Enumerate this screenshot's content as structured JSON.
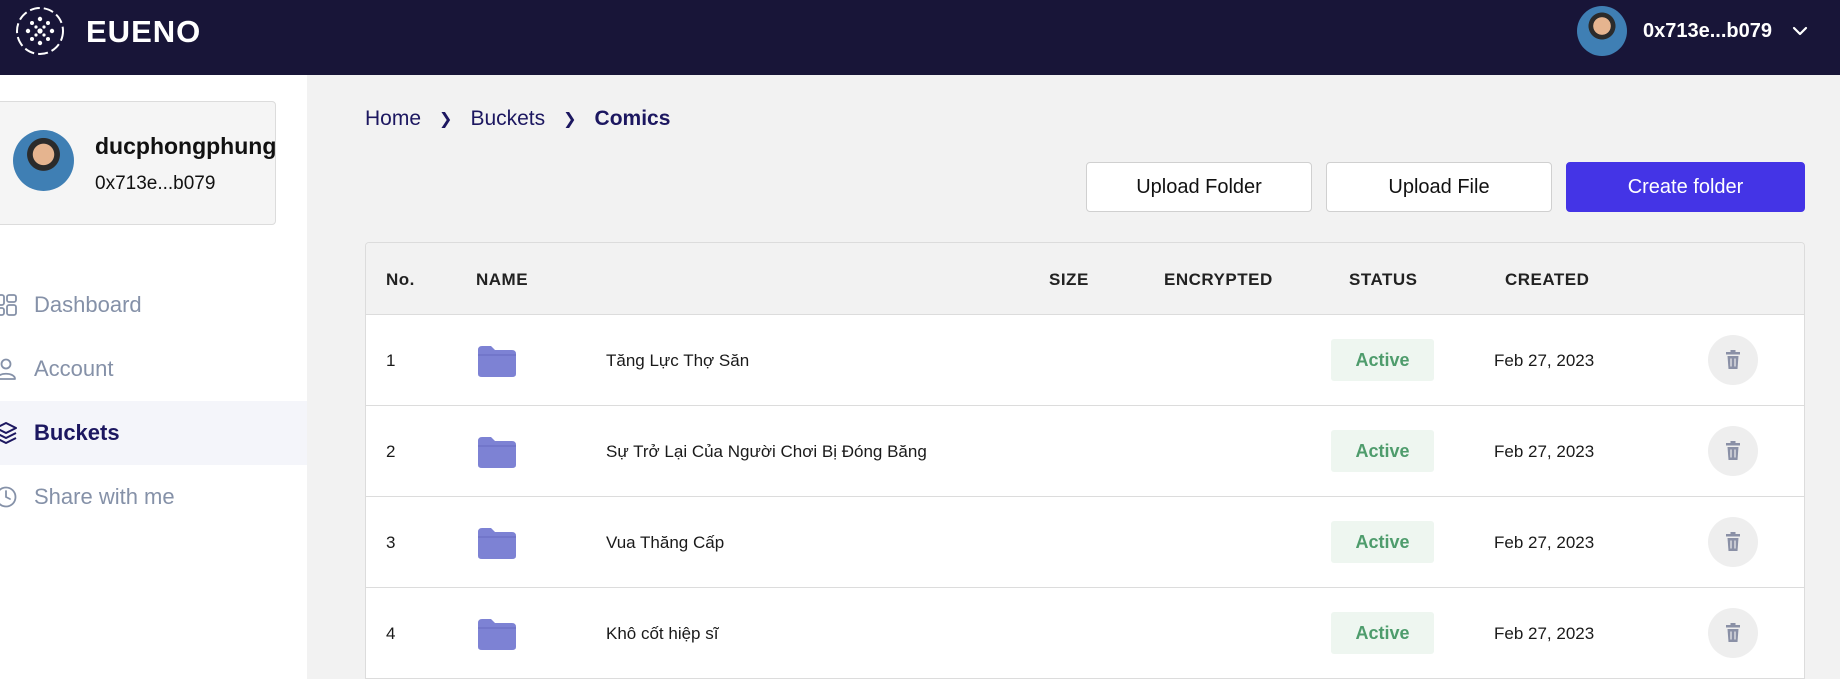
{
  "header": {
    "brand": "EUENO",
    "user_address": "0x713e...b079"
  },
  "sidebar": {
    "profile": {
      "name": "ducphongphung",
      "address": "0x713e...b079"
    },
    "items": [
      {
        "label": "Dashboard",
        "icon": "dashboard-icon",
        "active": false
      },
      {
        "label": "Account",
        "icon": "user-icon",
        "active": false
      },
      {
        "label": "Buckets",
        "icon": "layers-icon",
        "active": true
      },
      {
        "label": "Share with me",
        "icon": "clock-icon",
        "active": false
      }
    ]
  },
  "breadcrumb": [
    "Home",
    "Buckets",
    "Comics"
  ],
  "actions": {
    "upload_folder": "Upload Folder",
    "upload_file": "Upload File",
    "create_folder": "Create folder"
  },
  "table": {
    "columns": [
      "No.",
      "NAME",
      "SIZE",
      "ENCRYPTED",
      "STATUS",
      "CREATED"
    ],
    "rows": [
      {
        "no": "1",
        "name": "Tăng Lực Thợ Săn",
        "size": "",
        "encrypted": "",
        "status": "Active",
        "created": "Feb 27, 2023"
      },
      {
        "no": "2",
        "name": "Sự Trở Lại Của Người Chơi Bị Đóng Băng",
        "size": "",
        "encrypted": "",
        "status": "Active",
        "created": "Feb 27, 2023"
      },
      {
        "no": "3",
        "name": "Vua Thăng Cấp",
        "size": "",
        "encrypted": "",
        "status": "Active",
        "created": "Feb 27, 2023"
      },
      {
        "no": "4",
        "name": "Khô cốt hiệp sĩ",
        "size": "",
        "encrypted": "",
        "status": "Active",
        "created": "Feb 27, 2023"
      }
    ]
  },
  "colors": {
    "topbar": "#181538",
    "primary": "#4434e6",
    "active_nav": "#1c1760",
    "status_text": "#4e9c6c",
    "status_bg": "#eef6f0",
    "folder": "#7d82d4"
  }
}
